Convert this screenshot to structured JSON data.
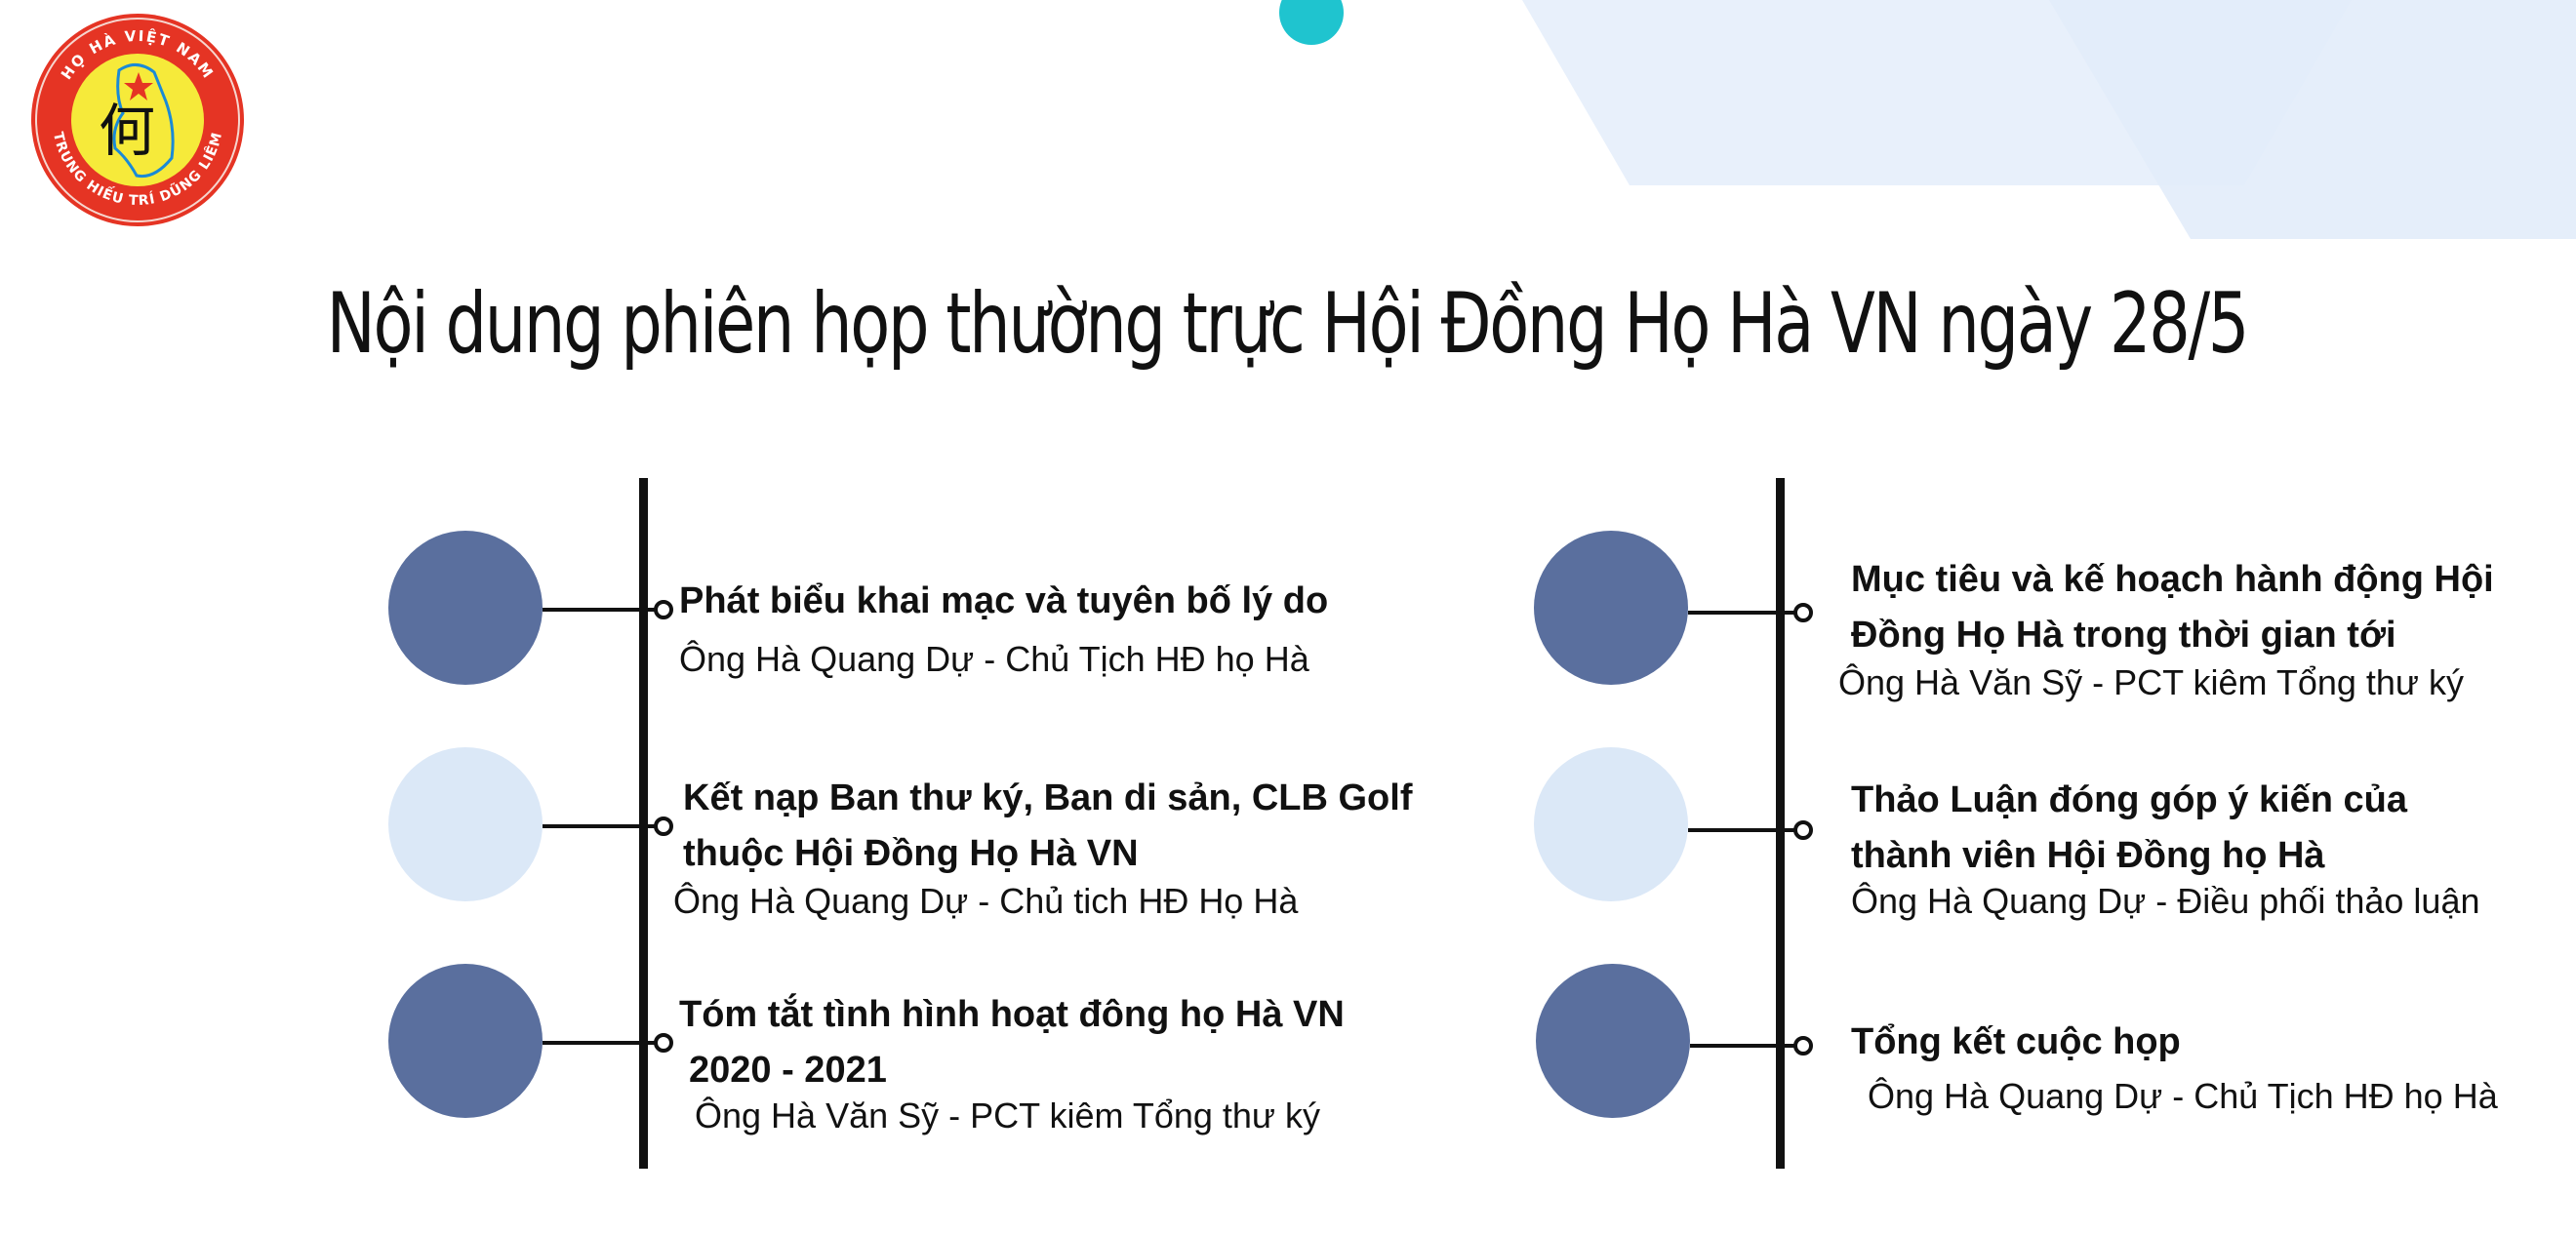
{
  "logo": {
    "ring_text": "HỌ HÀ VIỆT NAM",
    "motto_text": "TRUNG HIẾU TRÍ DŨNG LIÊM",
    "glyph": "何"
  },
  "title": "Nội dung phiên họp thường trực Hội Đồng Họ Hà VN ngày 28/5",
  "colors": {
    "circle_dark": "#5a6f9e",
    "circle_light": "#dbe8f7",
    "accent_dot": "#1fc4cf",
    "bg_shape": "#e6eefa"
  },
  "agenda_left": [
    {
      "title_lines": [
        "Phát biểu khai mạc và tuyên bố lý do"
      ],
      "speaker": "Ông Hà Quang Dự - Chủ Tịch HĐ họ Hà"
    },
    {
      "title_lines": [
        "Kết nạp Ban thư ký, Ban di sản, CLB Golf",
        "thuộc Hội Đồng Họ Hà VN"
      ],
      "speaker": "Ông Hà Quang Dự - Chủ tich HĐ Họ Hà"
    },
    {
      "title_lines": [
        "Tóm tắt tình hình hoạt đông họ Hà VN",
        "2020 - 2021"
      ],
      "speaker": "Ông Hà Văn Sỹ - PCT kiêm Tổng thư ký"
    }
  ],
  "agenda_right": [
    {
      "title_lines": [
        "Mục tiêu và kế hoạch hành động Hội",
        "Đồng Họ Hà trong thời gian tới"
      ],
      "speaker": "Ông Hà Văn Sỹ - PCT kiêm Tổng thư ký"
    },
    {
      "title_lines": [
        "Thảo Luận đóng góp ý kiến của",
        "thành viên Hội Đồng họ Hà"
      ],
      "speaker": "Ông Hà Quang Dự - Điều phối thảo luận"
    },
    {
      "title_lines": [
        "Tổng kết cuộc họp"
      ],
      "speaker": "Ông Hà Quang Dự - Chủ Tịch HĐ họ Hà"
    }
  ]
}
